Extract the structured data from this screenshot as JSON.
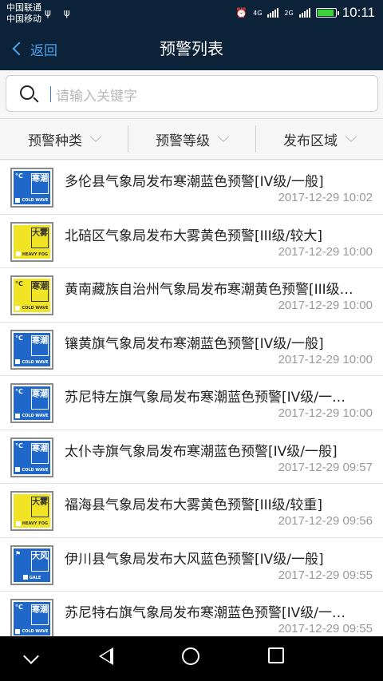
{
  "status_bar": {
    "carrier_1": "中国联通",
    "carrier_2": "中国移动",
    "usb": "ψ ψ",
    "alarm_glyph": "⏰",
    "net_1": "4G",
    "net_2": "2G",
    "time": "10:11",
    "battery_level": 0.85,
    "battery_color": "#3bd13b"
  },
  "nav": {
    "back_label": "返回",
    "title": "预警列表"
  },
  "search": {
    "placeholder": "请输入关键字"
  },
  "filters": [
    {
      "label": "预警种类"
    },
    {
      "label": "预警等级"
    },
    {
      "label": "发布区域"
    }
  ],
  "warnings": [
    {
      "headline": "多伦县气象局发布寒潮蓝色预警[IV级/一般]",
      "time": "2017-12-29 10:02",
      "badge": {
        "type": "blue",
        "glyph": "°C",
        "label": "寒潮",
        "caption": "COLD WAVE"
      }
    },
    {
      "headline": "北碚区气象局发布大雾黄色预警[III级/较大]",
      "time": "2017-12-29 10:00",
      "badge": {
        "type": "yellow",
        "glyph": "",
        "label": "大雾",
        "caption": "HEAVY FOG"
      }
    },
    {
      "headline": "黄南藏族自治州气象局发布寒潮黄色预警[III级…",
      "time": "2017-12-29 10:00",
      "badge": {
        "type": "yellow",
        "glyph": "°C",
        "label": "寒潮",
        "caption": "COLD WAVE"
      }
    },
    {
      "headline": "镶黄旗气象局发布寒潮蓝色预警[IV级/一般]",
      "time": "2017-12-29 10:00",
      "badge": {
        "type": "blue",
        "glyph": "°C",
        "label": "寒潮",
        "caption": "COLD WAVE"
      }
    },
    {
      "headline": "苏尼特左旗气象局发布寒潮蓝色预警[IV级/一…",
      "time": "2017-12-29 10:00",
      "badge": {
        "type": "blue",
        "glyph": "°C",
        "label": "寒潮",
        "caption": "COLD WAVE"
      }
    },
    {
      "headline": "太仆寺旗气象局发布寒潮蓝色预警[IV级/一般]",
      "time": "2017-12-29 09:57",
      "badge": {
        "type": "blue",
        "glyph": "°C",
        "label": "寒潮",
        "caption": "COLD WAVE"
      }
    },
    {
      "headline": "福海县气象局发布大雾黄色预警[III级/较重]",
      "time": "2017-12-29 09:56",
      "badge": {
        "type": "yellow",
        "glyph": "",
        "label": "大雾",
        "caption": "HEAVY FOG"
      }
    },
    {
      "headline": "伊川县气象局发布大风蓝色预警[IV级/一般]",
      "time": "2017-12-29 09:55",
      "badge": {
        "type": "blue",
        "glyph": "⚑",
        "label": "大风",
        "caption": "GALE"
      }
    },
    {
      "headline": "苏尼特右旗气象局发布寒潮蓝色预警[IV级/一…",
      "time": "2017-12-29 09:55",
      "badge": {
        "type": "blue",
        "glyph": "°C",
        "label": "寒潮",
        "caption": "COLD WAVE"
      }
    }
  ],
  "android_nav": [
    "nav-down-icon",
    "nav-back-icon",
    "nav-home-icon",
    "nav-recents-icon"
  ]
}
